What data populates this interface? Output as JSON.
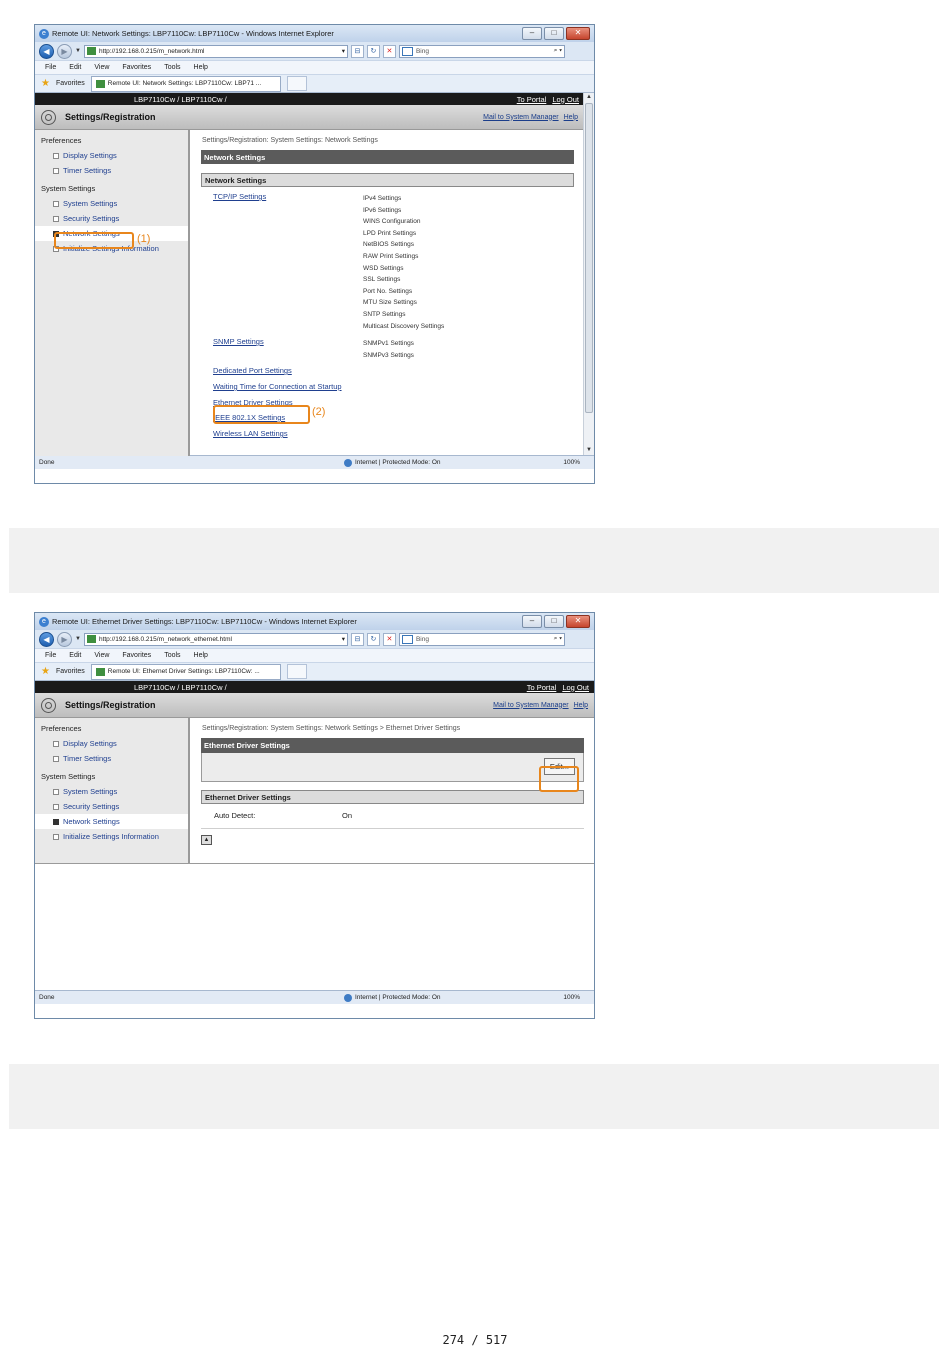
{
  "screen1": {
    "window_title": "Remote UI: Network Settings: LBP7110Cw: LBP7110Cw - Windows Internet Explorer",
    "url": "http://192.168.0.215/m_network.html",
    "search_text": "Bing",
    "menu": [
      "File",
      "Edit",
      "View",
      "Favorites",
      "Tools",
      "Help"
    ],
    "favorites_label": "Favorites",
    "tab_label": "Remote UI: Network Settings: LBP7110Cw: LBP71 ...",
    "model": "LBP7110Cw / LBP7110Cw /",
    "to_portal": "To Portal",
    "log_out": "Log Out",
    "header_title": "Settings/Registration",
    "mail_link": "Mail to System Manager",
    "help_link": "Help",
    "nav": {
      "preferences": "Preferences",
      "display_settings": "Display Settings",
      "timer_settings": "Timer Settings",
      "system_settings_group": "System Settings",
      "system_settings": "System Settings",
      "security_settings": "Security Settings",
      "network_settings": "Network Settings",
      "initialize": "Initialize Settings Information"
    },
    "breadcrumb": "Settings/Registration: System Settings: Network Settings",
    "section_title": "Network Settings",
    "subsection_title": "Network Settings",
    "links": {
      "tcpip": "TCP/IP Settings",
      "tcpip_sub": [
        "IPv4 Settings",
        "IPv6 Settings",
        "WINS Configuration",
        "LPD Print Settings",
        "NetBIOS Settings",
        "RAW Print Settings",
        "WSD Settings",
        "SSL Settings",
        "Port No. Settings",
        "MTU Size Settings",
        "SNTP Settings",
        "Multicast Discovery Settings"
      ],
      "snmp": "SNMP Settings",
      "snmp_sub": [
        "SNMPv1 Settings",
        "SNMPv3 Settings"
      ],
      "dedicated_port": "Dedicated Port Settings",
      "waiting_time": "Waiting Time for Connection at Startup",
      "ethernet": "Ethernet Driver Settings",
      "ieee": "IEEE 802.1X Settings",
      "wireless": "Wireless LAN Settings"
    },
    "callout1": "(1)",
    "callout2": "(2)",
    "status_done": "Done",
    "status_zone": "Internet | Protected Mode: On",
    "zoom": "100%"
  },
  "screen2": {
    "window_title": "Remote UI: Ethernet Driver Settings: LBP7110Cw: LBP7110Cw - Windows Internet Explorer",
    "url": "http://192.168.0.215/m_network_ethernet.html",
    "search_text": "Bing",
    "menu": [
      "File",
      "Edit",
      "View",
      "Favorites",
      "Tools",
      "Help"
    ],
    "favorites_label": "Favorites",
    "tab_label": "Remote UI: Ethernet Driver Settings: LBP7110Cw: ...",
    "model": "LBP7110Cw / LBP7110Cw /",
    "to_portal": "To Portal",
    "log_out": "Log Out",
    "header_title": "Settings/Registration",
    "mail_link": "Mail to System Manager",
    "help_link": "Help",
    "nav": {
      "preferences": "Preferences",
      "display_settings": "Display Settings",
      "timer_settings": "Timer Settings",
      "system_settings_group": "System Settings",
      "system_settings": "System Settings",
      "security_settings": "Security Settings",
      "network_settings": "Network Settings",
      "initialize": "Initialize Settings Information"
    },
    "breadcrumb": "Settings/Registration: System Settings: Network Settings > Ethernet Driver Settings",
    "section_title": "Ethernet Driver Settings",
    "edit_button": "Edit...",
    "subsection_title": "Ethernet Driver Settings",
    "auto_detect_label": "Auto Detect:",
    "auto_detect_value": "On",
    "status_done": "Done",
    "status_zone": "Internet | Protected Mode: On",
    "zoom": "100%"
  },
  "page_number": "274 / 517",
  "colors": {
    "highlight": "#e8861c",
    "header_black": "#1a1a1a",
    "link": "#1f3f8f"
  }
}
